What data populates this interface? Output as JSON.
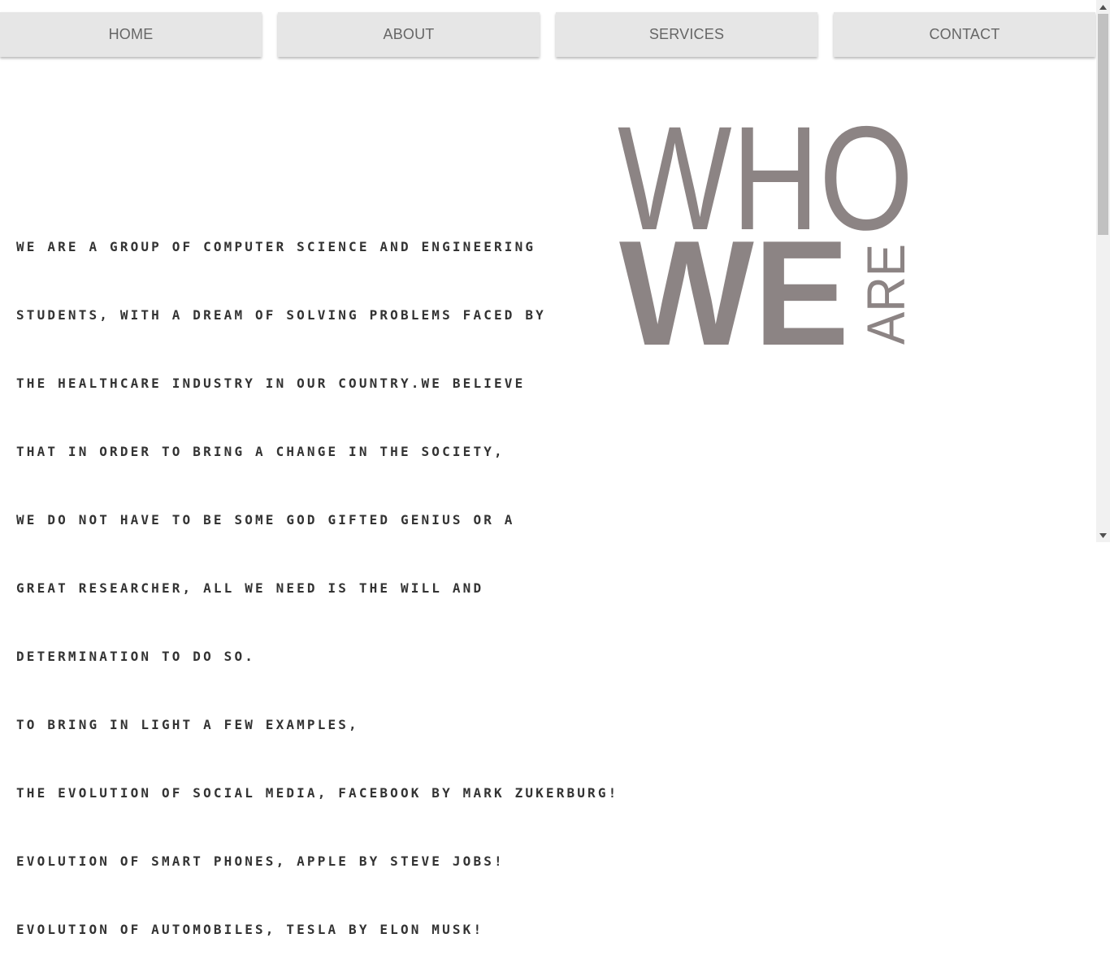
{
  "nav": {
    "items": [
      {
        "label": "HOME"
      },
      {
        "label": "ABOUT"
      },
      {
        "label": "SERVICES"
      },
      {
        "label": "CONTACT"
      }
    ]
  },
  "about": {
    "lines": [
      "WE ARE A GROUP OF COMPUTER SCIENCE AND ENGINEERING",
      "STUDENTS, WITH A DREAM OF SOLVING PROBLEMS FACED BY",
      "THE HEALTHCARE INDUSTRY IN OUR COUNTRY.WE BELIEVE",
      "THAT IN ORDER TO BRING A CHANGE IN THE SOCIETY,",
      "WE DO NOT HAVE TO BE SOME GOD GIFTED GENIUS OR A",
      "GREAT RESEARCHER, ALL WE NEED IS THE WILL AND",
      "DETERMINATION TO DO SO.",
      "TO BRING IN LIGHT A FEW EXAMPLES,",
      "THE EVOLUTION OF SOCIAL MEDIA, FACEBOOK BY MARK ZUKERBURG!",
      "EVOLUTION OF SMART PHONES, APPLE BY STEVE JOBS!",
      "EVOLUTION OF AUTOMOBILES, TESLA BY ELON MUSK!"
    ]
  },
  "graphic": {
    "who": "WHO",
    "we": "WE",
    "are": "ARE",
    "color": "#8c8484"
  },
  "scrollbar": {
    "up_icon": "▲",
    "down_icon": "▼"
  }
}
